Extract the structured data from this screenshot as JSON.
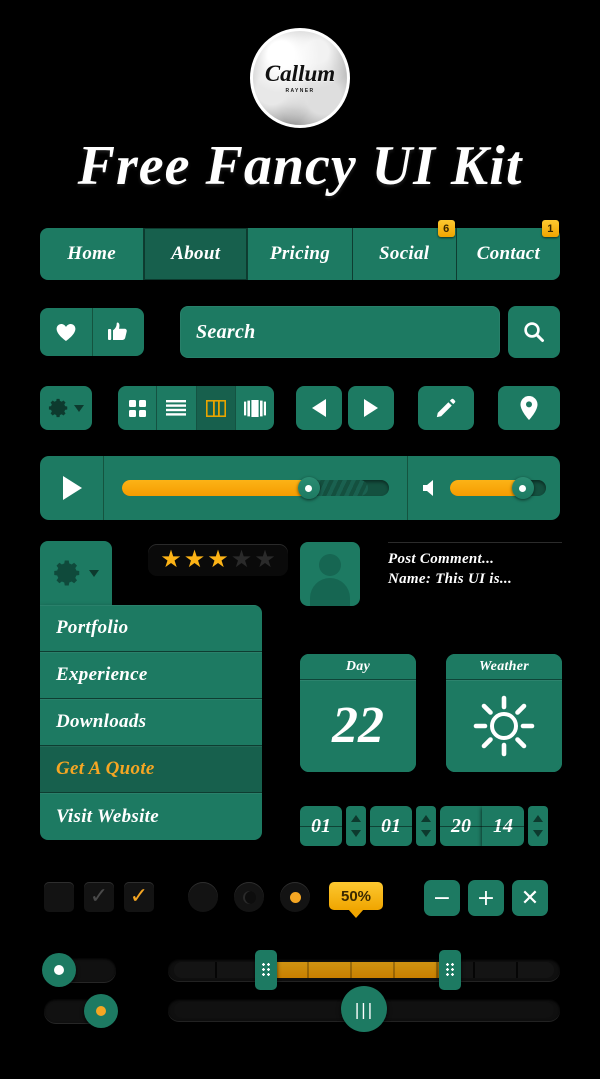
{
  "logo": {
    "name": "Callum",
    "subtitle": "RAYNER",
    "icon": "cloud-badge-logo"
  },
  "title": "Free Fancy UI Kit",
  "nav": {
    "items": [
      {
        "label": "Home",
        "active": false,
        "badge": ""
      },
      {
        "label": "About",
        "active": true,
        "badge": ""
      },
      {
        "label": "Pricing",
        "active": false,
        "badge": ""
      },
      {
        "label": "Social",
        "active": false,
        "badge": "6"
      },
      {
        "label": "Contact",
        "active": false,
        "badge": "1"
      }
    ]
  },
  "actions": {
    "like_icon": "heart-icon",
    "thumb_icon": "thumbs-up-icon"
  },
  "search": {
    "value": "Search",
    "placeholder": "Search",
    "button_icon": "search-icon"
  },
  "toolbar": {
    "settings_icon": "gear-icon",
    "settings_caret": "chevron-down-icon",
    "views": [
      {
        "icon": "grid-view-icon",
        "active": false
      },
      {
        "icon": "list-view-icon",
        "active": false
      },
      {
        "icon": "column-view-icon",
        "active": true
      },
      {
        "icon": "carousel-view-icon",
        "active": false
      }
    ],
    "prev_icon": "arrow-left-icon",
    "next_icon": "arrow-right-icon",
    "edit_icon": "pencil-icon",
    "location_icon": "map-pin-icon"
  },
  "player": {
    "play_icon": "play-icon",
    "progress_percent": 70,
    "buffer_percent": 92,
    "volume_icon": "speaker-icon",
    "volume_percent": 76
  },
  "gear_menu": {
    "trigger_icon": "gear-icon",
    "trigger_caret": "chevron-down-icon",
    "items": [
      {
        "label": "Portfolio",
        "active": false
      },
      {
        "label": "Experience",
        "active": false
      },
      {
        "label": "Downloads",
        "active": false
      },
      {
        "label": "Get A Quote",
        "active": true
      },
      {
        "label": "Visit Website",
        "active": false
      }
    ]
  },
  "rating": {
    "total": 5,
    "filled": 3,
    "icon": "star-icon"
  },
  "comment": {
    "avatar_icon": "user-avatar-icon",
    "line1": "Post Comment...",
    "line2": "Name: This UI is..."
  },
  "widgets": [
    {
      "title": "Day",
      "value": "22",
      "icon": ""
    },
    {
      "title": "Weather",
      "value": "",
      "icon": "sun-icon"
    }
  ],
  "date_steppers": {
    "fields": [
      {
        "value": "01",
        "spinner": true
      },
      {
        "value": "01",
        "spinner": true
      },
      {
        "value": "20",
        "spinner": false
      },
      {
        "value": "14",
        "spinner": true
      }
    ],
    "up_icon": "caret-up-icon",
    "down_icon": "caret-down-icon"
  },
  "checkboxes": [
    {
      "state": "unchecked",
      "glyph": ""
    },
    {
      "state": "checked-muted",
      "glyph": "✓"
    },
    {
      "state": "checked-active",
      "glyph": "✓"
    }
  ],
  "radios": [
    {
      "state": "unselected"
    },
    {
      "state": "hover"
    },
    {
      "state": "selected"
    }
  ],
  "tooltip": {
    "label": "50%"
  },
  "ops": [
    {
      "glyph": "−",
      "name": "minus-button"
    },
    {
      "glyph": "+",
      "name": "plus-button"
    },
    {
      "glyph": "✕",
      "name": "close-button"
    }
  ],
  "toggles": [
    {
      "state": "off",
      "knob": "white"
    },
    {
      "state": "on",
      "knob": "gold"
    }
  ],
  "sliders": {
    "range": {
      "start_percent": 25,
      "end_percent": 72,
      "handle_icon": "grip-dots-icon"
    },
    "single": {
      "value_percent": 50,
      "handle_icon": "grip-lines-icon"
    }
  },
  "colors": {
    "background": "#000000",
    "green": "#1d7a62",
    "green_dark": "#17604d",
    "accent_orange": "#f5a623",
    "accent_yellow": "#fcb316",
    "text": "#ffffff"
  }
}
